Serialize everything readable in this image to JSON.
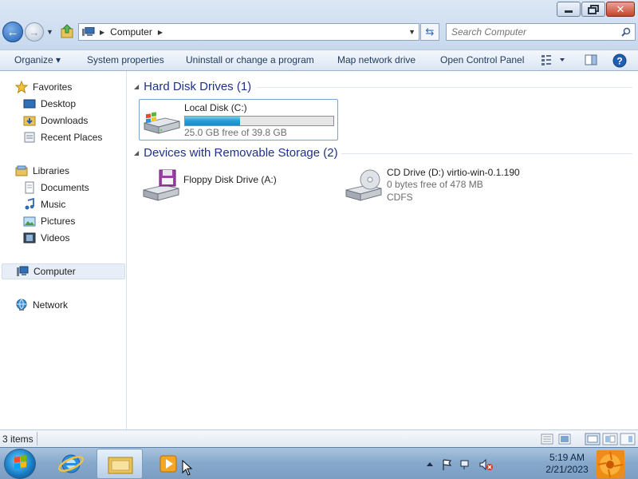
{
  "window": {
    "minimize_label": "minimize",
    "maximize_label": "restore",
    "close_label": "close"
  },
  "address": {
    "crumb": "Computer",
    "search_placeholder": "Search Computer"
  },
  "toolbar": {
    "organize": "Organize ▾",
    "system_properties": "System properties",
    "uninstall": "Uninstall or change a program",
    "map_drive": "Map network drive",
    "control_panel": "Open Control Panel"
  },
  "nav": {
    "favorites": "Favorites",
    "desktop": "Desktop",
    "downloads": "Downloads",
    "recent": "Recent Places",
    "libraries": "Libraries",
    "documents": "Documents",
    "music": "Music",
    "pictures": "Pictures",
    "videos": "Videos",
    "computer": "Computer",
    "network": "Network"
  },
  "groups": {
    "hdd": "Hard Disk Drives (1)",
    "removable": "Devices with Removable Storage (2)"
  },
  "drives": {
    "c": {
      "name": "Local Disk (C:)",
      "free": "25.0 GB free of 39.8 GB",
      "used_fraction": 0.37
    },
    "a": {
      "name": "Floppy Disk Drive (A:)"
    },
    "d": {
      "name": "CD Drive (D:) virtio-win-0.1.190",
      "free": "0 bytes free of 478 MB",
      "fs": "CDFS"
    }
  },
  "status": {
    "count": "3 items"
  },
  "taskbar": {
    "time": "5:19 AM",
    "date": "2/21/2023"
  },
  "colors": {
    "accent": "#1e3287",
    "bar_fill": "#26a0da"
  }
}
